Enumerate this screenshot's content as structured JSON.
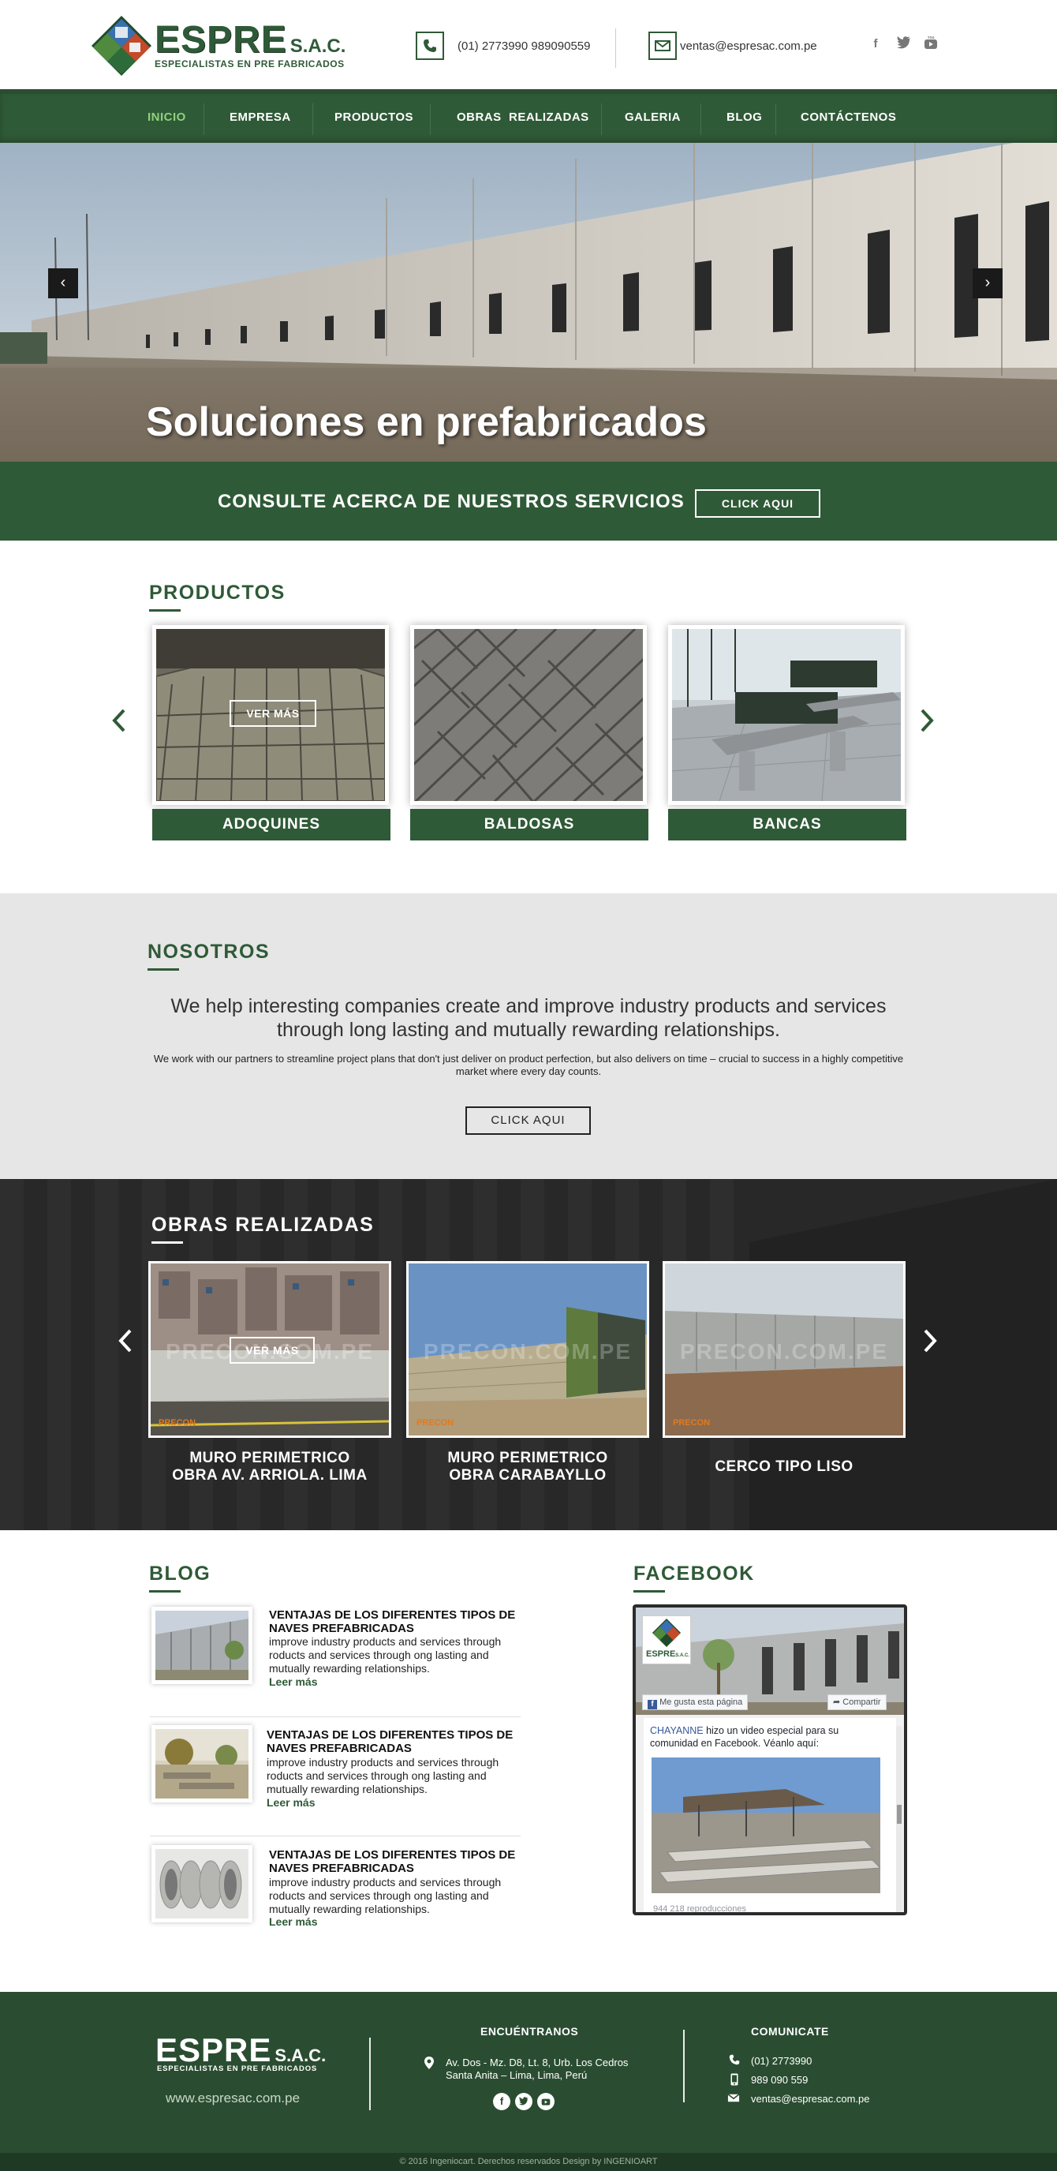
{
  "header": {
    "logo_main": "ESPRE",
    "logo_sac": "S.A.C.",
    "logo_tagline": "ESPECIALISTAS EN PRE FABRICADOS",
    "phone_text": "(01) 2773990    989090559",
    "email_text": "ventas@espresac.com.pe",
    "social": [
      "f",
      "t",
      "yt"
    ],
    "icons": [
      "phone-icon",
      "mail-icon",
      "facebook-icon",
      "twitter-icon",
      "youtube-icon"
    ]
  },
  "nav": {
    "items": [
      "INICIO",
      "EMPRESA",
      "PRODUCTOS",
      "OBRAS  REALIZADAS",
      "GALERIA",
      "BLOG",
      "CONTÁCTENOS"
    ],
    "active": "INICIO"
  },
  "hero": {
    "title": "Soluciones en prefabricados",
    "prev": "‹",
    "next": "›"
  },
  "cta": {
    "text": "CONSULTE ACERCA DE NUESTROS SERVICIOS",
    "button": "CLICK AQUI"
  },
  "productos": {
    "title": "PRODUCTOS",
    "ver_mas": "VER MÁS",
    "items": [
      {
        "label": "ADOQUINES"
      },
      {
        "label": "BALDOSAS"
      },
      {
        "label": "BANCAS"
      }
    ]
  },
  "nosotros": {
    "title": "NOSOTROS",
    "lead": "We help interesting companies create and improve industry products and services through long lasting and mutually rewarding relationships.",
    "body": "We work with our partners to streamline project plans that don't just deliver on product perfection, but also delivers on time – crucial to success in a highly competitive market where every day counts.",
    "button": "CLICK AQUI"
  },
  "obras": {
    "title": "OBRAS REALIZADAS",
    "ver_mas": "VER MÁS",
    "watermark": "PRECON.COM.PE",
    "brand_tag": "PRECON",
    "items": [
      {
        "line1": "MURO PERIMETRICO",
        "line2": "OBRA AV. ARRIOLA. LIMA"
      },
      {
        "line1": "MURO PERIMETRICO",
        "line2": "OBRA CARABAYLLO"
      },
      {
        "line1": "CERCO TIPO LISO",
        "line2": ""
      }
    ]
  },
  "blog": {
    "title": "BLOG",
    "posts": [
      {
        "title": "VENTAJAS DE LOS DIFERENTES TIPOS DE NAVES PREFABRICADAS",
        "body": "improve industry products and services through roducts and services through ong lasting and mutually rewarding relationships.",
        "more": "Leer más"
      },
      {
        "title": "VENTAJAS DE LOS DIFERENTES TIPOS DE NAVES PREFABRICADAS",
        "body": "improve industry products and services through roducts and services through ong lasting and mutually rewarding relationships.",
        "more": "Leer más"
      },
      {
        "title": "VENTAJAS DE LOS DIFERENTES TIPOS DE NAVES PREFABRICADAS",
        "body": "improve industry products and services through roducts and services through ong lasting and mutually rewarding relationships.",
        "more": "Leer más"
      }
    ]
  },
  "facebook": {
    "title": "FACEBOOK",
    "like": "Me gusta esta página",
    "share": "Compartir",
    "post_author": "CHAYANNE",
    "post_text": " hizo un video especial para su comunidad en Facebook. Véanlo aquí:",
    "views": "944 218 reproducciones",
    "mini_logo": "ESPRE",
    "mini_sac": "S.A.C."
  },
  "footer": {
    "logo_main": "ESPRE",
    "logo_sac": "S.A.C.",
    "logo_tagline": "ESPECIALISTAS EN PRE FABRICADOS",
    "website": "www.espresac.com.pe",
    "find_title": "ENCUÉNTRANOS",
    "address_1": "Av. Dos - Mz. D8, Lt. 8, Urb. Los Cedros",
    "address_2": "Santa Anita – Lima, Lima, Perú",
    "contact_title": "COMUNICATE",
    "phone": "(01) 2773990",
    "mobile": "989 090 559",
    "email": "ventas@espresac.com.pe",
    "copyright": "© 2016 Ingeniocart. Derechos reservados Design by INGENIOART"
  },
  "colors": {
    "primary_green": "#2f5a37",
    "nav_active": "#8fd07b",
    "footer_green": "#2a4d31"
  }
}
